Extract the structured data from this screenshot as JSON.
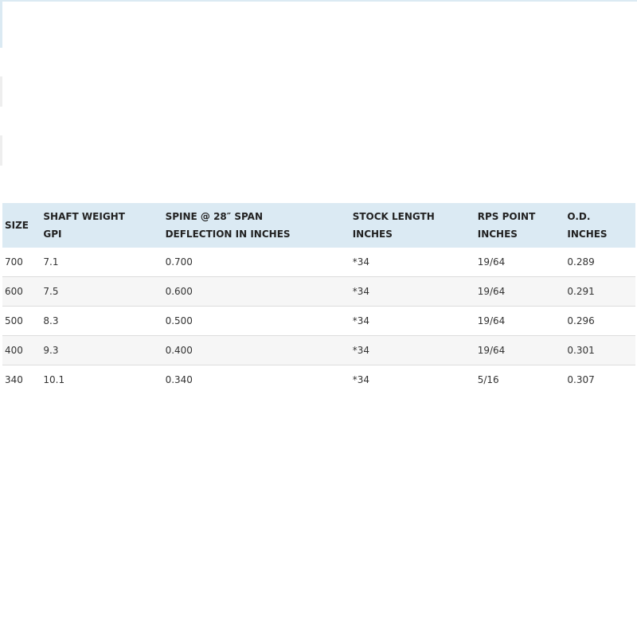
{
  "table": {
    "headers": [
      [
        "SIZE"
      ],
      [
        "SHAFT WEIGHT",
        "GPI"
      ],
      [
        "SPINE @ 28″ SPAN",
        "DEFLECTION IN INCHES"
      ],
      [
        "STOCK LENGTH",
        "INCHES"
      ],
      [
        "RPS POINT",
        "INCHES"
      ],
      [
        "O.D.",
        "INCHES"
      ]
    ],
    "rows": [
      [
        "700",
        "7.1",
        "0.700",
        "*34",
        "19/64",
        "0.289"
      ],
      [
        "600",
        "7.5",
        "0.600",
        "*34",
        "19/64",
        "0.291"
      ],
      [
        "500",
        "8.3",
        "0.500",
        "*34",
        "19/64",
        "0.296"
      ],
      [
        "400",
        "9.3",
        "0.400",
        "*34",
        "19/64",
        "0.301"
      ],
      [
        "340",
        "10.1",
        "0.340",
        "*34",
        "5/16",
        "0.307"
      ]
    ]
  },
  "colors": {
    "header_bg": "#dbeaf3",
    "alt_row_bg": "#f6f6f6",
    "row_border": "#dddddd"
  }
}
